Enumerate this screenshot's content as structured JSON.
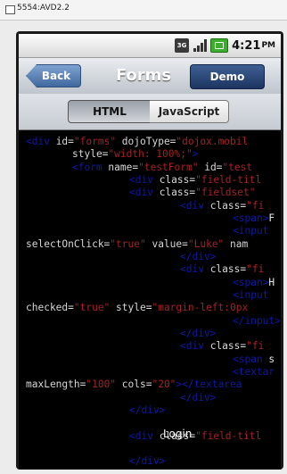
{
  "window": {
    "title": "5554:AVD2.2"
  },
  "status_bar": {
    "network": "3G",
    "time": "4:21",
    "ampm": "PM"
  },
  "heading": {
    "back_label": "Back",
    "title": "Forms",
    "demo_label": "Demo"
  },
  "tabs": [
    {
      "label": "HTML",
      "selected": true
    },
    {
      "label": "JavaScript",
      "selected": false
    }
  ],
  "code": {
    "l1": {
      "tag": "<div",
      "a1": " id=",
      "v1": "\"forms\"",
      "a2": " dojoType=",
      "v2": "\"dojox.mobil"
    },
    "l2": {
      "a1": "style=",
      "v1": "\"width: 100%;\"",
      "rest": ">"
    },
    "l3": {
      "tag": "<form",
      "a1": " name=",
      "v1": "\"testForm\"",
      "a2": " id=",
      "v2": "\"test"
    },
    "l4": {
      "tag": "<div",
      "a1": " class=",
      "v1": "\"field-titl"
    },
    "l5": {
      "tag": "<div",
      "a1": " class=",
      "v1": "\"fieldset\""
    },
    "l6": {
      "tag": "<div",
      "a1": " class=",
      "v1": "\"fi"
    },
    "l7": {
      "tag": "<span>",
      "rest": "F"
    },
    "l8": {
      "tag": "<input"
    },
    "l9": {
      "a1": "selectOnClick=",
      "v1": "\"true\"",
      "a2": " value=",
      "v2": "\"Luke\"",
      "a3": " nam"
    },
    "l10": {
      "tag": "</div>"
    },
    "l11": {
      "tag": "<div",
      "a1": " class=",
      "v1": "\"fi"
    },
    "l12": {
      "tag": "<span>",
      "rest": "H"
    },
    "l13": {
      "tag": "<input"
    },
    "l14": {
      "a1": "checked=",
      "v1": "\"true\"",
      "a2": " style=",
      "v2": "\"margin-left:0px"
    },
    "l15": {
      "tag": "</input>"
    },
    "l16": {
      "tag": "</div>"
    },
    "l17": {
      "tag": "<div",
      "a1": " class=",
      "v1": "\"fi"
    },
    "l18": {
      "tag": "<span",
      "rest": " s"
    },
    "l19": {
      "tag": "<textar"
    },
    "l20": {
      "a1": "maxLength=",
      "v1": "\"100\"",
      "a2": " cols=",
      "v2": "\"20\"",
      "tag": "></textarea"
    },
    "l21": {
      "tag": "</div>"
    },
    "l22": {
      "tag": "</div>"
    },
    "l23": {
      "tag": "<div",
      "a1": " class=",
      "v1": "\"field-titl"
    },
    "l24": {
      "tag": "</div>"
    }
  },
  "overlay_label": "Login"
}
